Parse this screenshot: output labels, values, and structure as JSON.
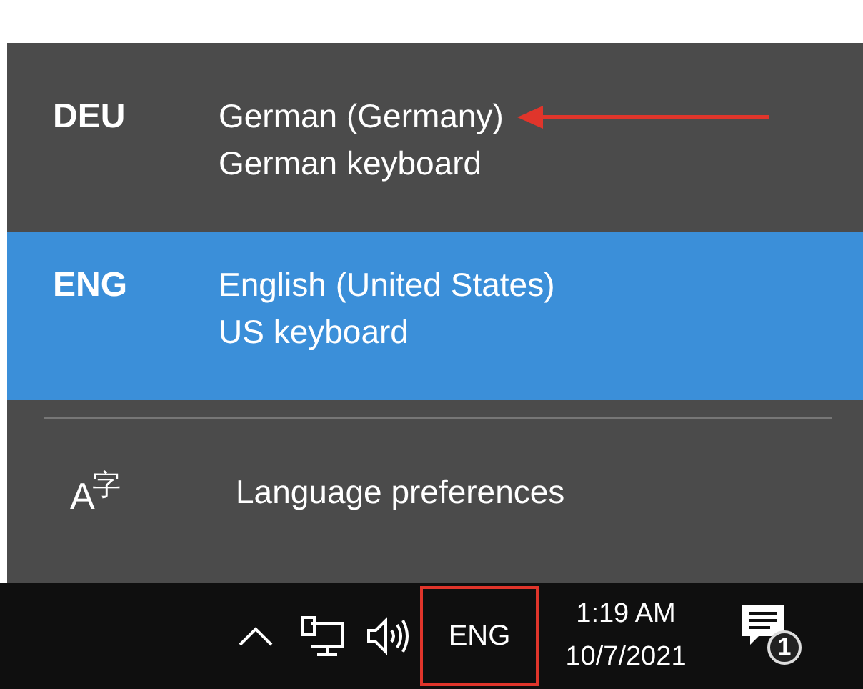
{
  "languages": [
    {
      "code": "DEU",
      "name": "German (Germany)",
      "keyboard": "German keyboard",
      "selected": false,
      "annotated": true
    },
    {
      "code": "ENG",
      "name": "English (United States)",
      "keyboard": "US keyboard",
      "selected": true,
      "annotated": false
    }
  ],
  "preferences": {
    "icon": "A$^{字}$",
    "label": "Language preferences"
  },
  "taskbar": {
    "input_indicator": {
      "label": "ENG",
      "highlighted": true
    },
    "time": "1:19 AM",
    "date": "10/7/2021",
    "notification_count": "1"
  }
}
